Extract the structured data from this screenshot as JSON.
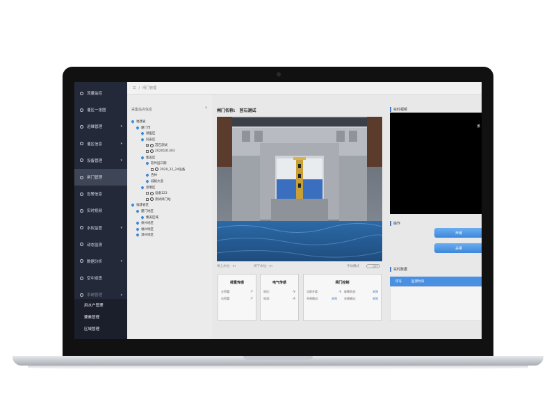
{
  "sidebar": {
    "items": [
      {
        "label": "流量监控",
        "icon": "chart-icon"
      },
      {
        "label": "灌区一张图",
        "icon": "map-icon"
      },
      {
        "label": "运维管理",
        "icon": "wrench-icon",
        "caret": "▾"
      },
      {
        "label": "灌区信息",
        "icon": "info-icon",
        "caret": "▾"
      },
      {
        "label": "设备管理",
        "icon": "device-icon",
        "caret": "▾"
      },
      {
        "label": "闸门管理",
        "icon": "gate-icon"
      },
      {
        "label": "告警信息",
        "icon": "alarm-icon"
      },
      {
        "label": "实时视频",
        "icon": "video-icon"
      },
      {
        "label": "水权监管",
        "icon": "water-icon",
        "caret": "▾"
      },
      {
        "label": "动态监测",
        "icon": "monitor-icon"
      },
      {
        "label": "数据分析",
        "icon": "analysis-icon",
        "caret": "▾"
      },
      {
        "label": "空中巡查",
        "icon": "drone-icon"
      },
      {
        "label": "系统管理",
        "icon": "settings-icon",
        "caret": "▴"
      }
    ],
    "submenu": [
      "用水户管理",
      "要素管理",
      "区域管理"
    ]
  },
  "topbar": {
    "menu_icon": "☰",
    "separator": "/",
    "crumb": "闸门管理"
  },
  "tree": {
    "title": "采集站点信息",
    "collapse": "‹",
    "nodes": [
      {
        "label": "福建省",
        "kind": "pin",
        "level": 0
      },
      {
        "label": "厦门市",
        "kind": "pin",
        "level": 1
      },
      {
        "label": "湖里区",
        "kind": "pin",
        "level": 2
      },
      {
        "label": "同安区",
        "kind": "pin",
        "level": 2
      },
      {
        "label": "莒石测试",
        "kind": "check",
        "level": 3,
        "checked": true
      },
      {
        "label": "2020101303",
        "kind": "check",
        "level": 3,
        "checked": false
      },
      {
        "label": "集美区",
        "kind": "pin",
        "level": 2
      },
      {
        "label": "软件园三期",
        "kind": "pin",
        "level": 3
      },
      {
        "label": "2020_11_24设备",
        "kind": "check",
        "level": 4,
        "checked": false
      },
      {
        "label": "杏林",
        "kind": "pin",
        "level": 3
      },
      {
        "label": "诚毅大道",
        "kind": "pin",
        "level": 3
      },
      {
        "label": "思明区",
        "kind": "pin",
        "level": 2
      },
      {
        "label": "设备123",
        "kind": "check",
        "level": 3,
        "checked": false
      },
      {
        "label": "测试闸门站",
        "kind": "check",
        "level": 3,
        "checked": false
      },
      {
        "label": "福建省区",
        "kind": "pin",
        "level": 0
      },
      {
        "label": "厦门地区",
        "kind": "pin",
        "level": 1
      },
      {
        "label": "集美区域",
        "kind": "pin",
        "level": 2
      },
      {
        "label": "泉州地区",
        "kind": "pin",
        "level": 1
      },
      {
        "label": "福州地区",
        "kind": "pin",
        "level": 1
      },
      {
        "label": "漳州地区",
        "kind": "pin",
        "level": 1
      }
    ]
  },
  "gate": {
    "name_label": "闸门名称:",
    "name_value": "莒石测试",
    "upstream_label": "闸上水位: -m",
    "downstream_label": "闸下水位: -m",
    "mode_label": "手动模式",
    "toggle_label": "OFF"
  },
  "cards": {
    "load": {
      "title": "荷重传感",
      "rows": [
        {
          "k": "左荷重:",
          "v": "-T"
        },
        {
          "k": "右荷重:",
          "v": "-T"
        }
      ]
    },
    "electric": {
      "title": "电气传感",
      "rows": [
        {
          "k": "电压:",
          "v": "-V"
        },
        {
          "k": "电流:",
          "v": "-A"
        }
      ]
    },
    "control": {
      "title": "闸门控制",
      "rows": [
        {
          "k": "当前开度:",
          "v": "-S",
          "k2": "故障状态:",
          "v2": "未知"
        },
        {
          "k": "开闸输出:",
          "v": "未知",
          "k2": "关闸输出:",
          "v2": "未知"
        }
      ]
    }
  },
  "right": {
    "video_title": "实时视频",
    "video_text": "该",
    "op_title": "操作",
    "open_btn": "开闸",
    "close_btn": "关闸",
    "data_title": "实时数据",
    "col_index": "序号",
    "col_time": "监测时间"
  },
  "colors": {
    "sidebar": "#24293a",
    "accent": "#4a90e2",
    "water": "#2e5f9a"
  }
}
